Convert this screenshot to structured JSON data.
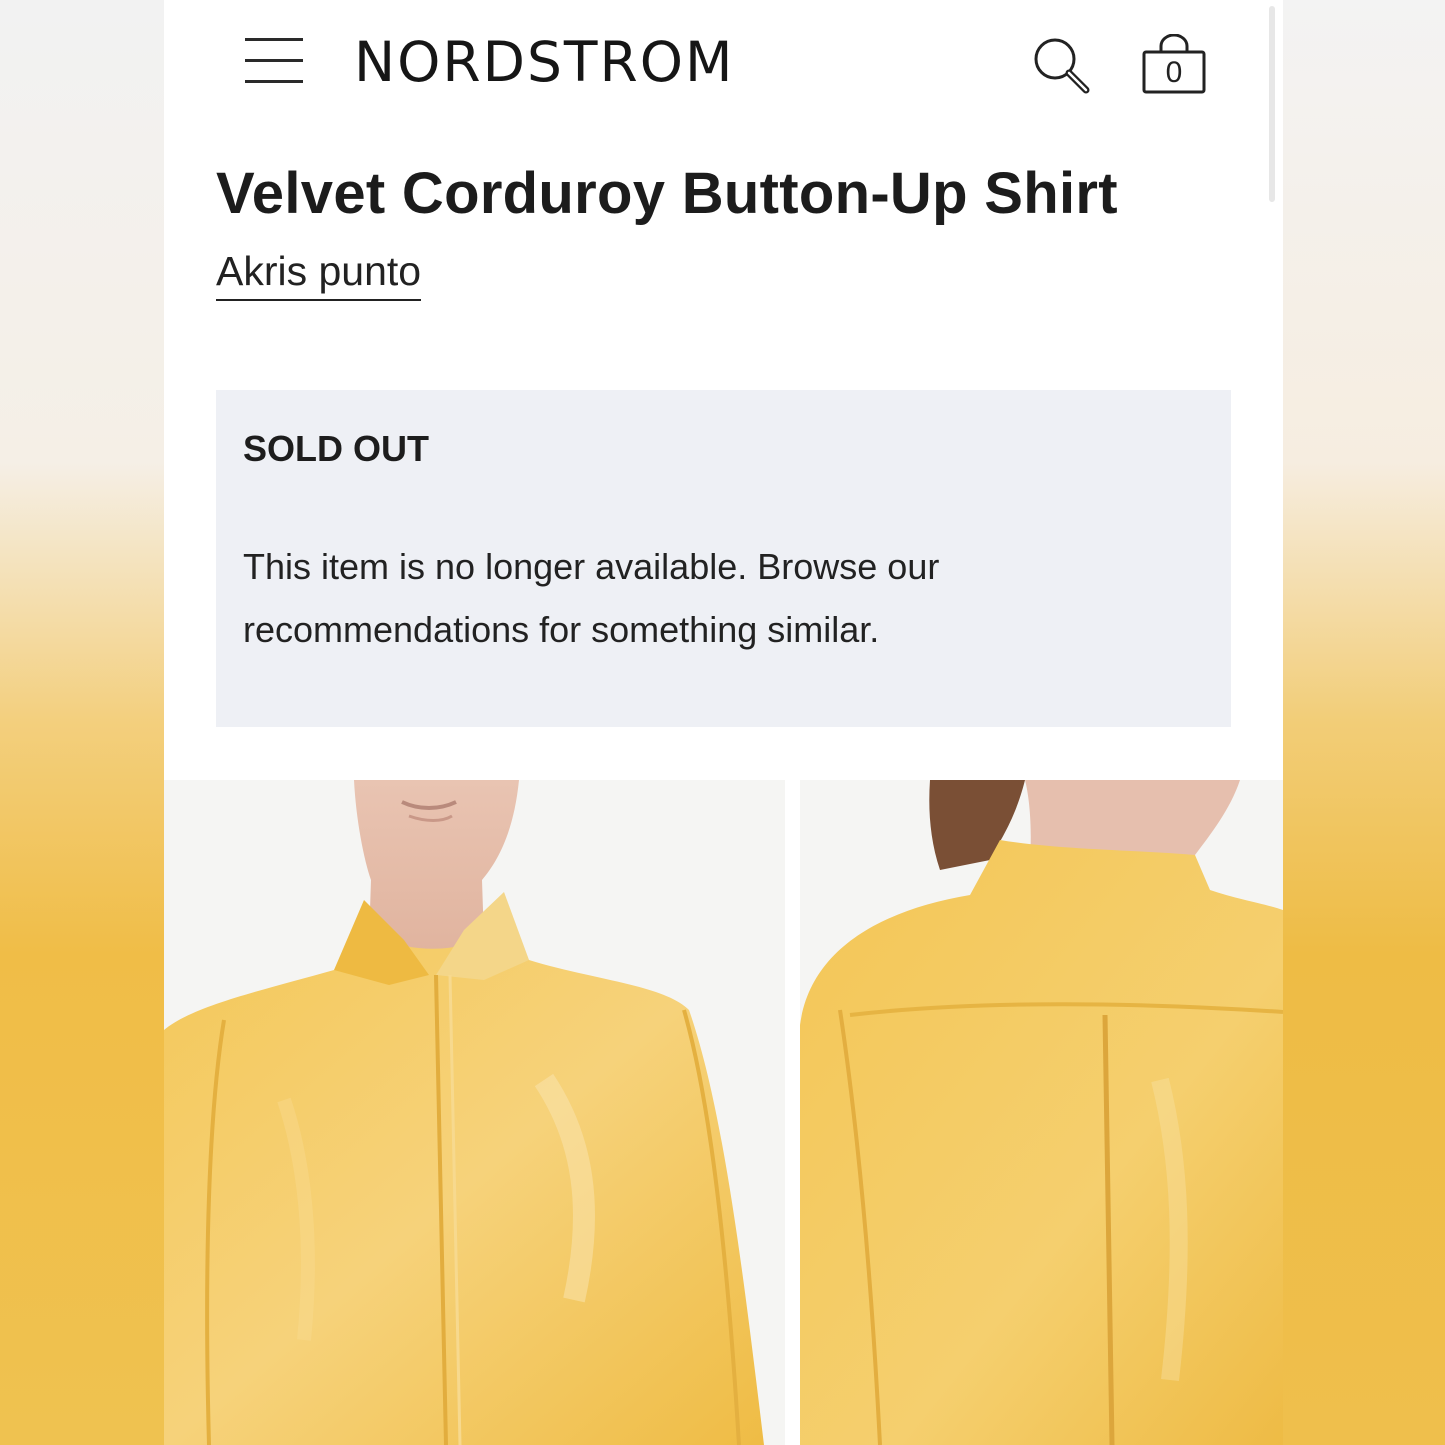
{
  "header": {
    "logo": "NORDSTROM",
    "bag_count": "0"
  },
  "product": {
    "title": "Velvet Corduroy Button-Up Shirt",
    "brand": "Akris punto"
  },
  "availability": {
    "heading": "SOLD OUT",
    "message": "This item is no longer available. Browse our recommendations for something similar."
  },
  "gallery": {
    "images": [
      "front-view",
      "back-view"
    ],
    "garment_color": "#f0c04c"
  }
}
